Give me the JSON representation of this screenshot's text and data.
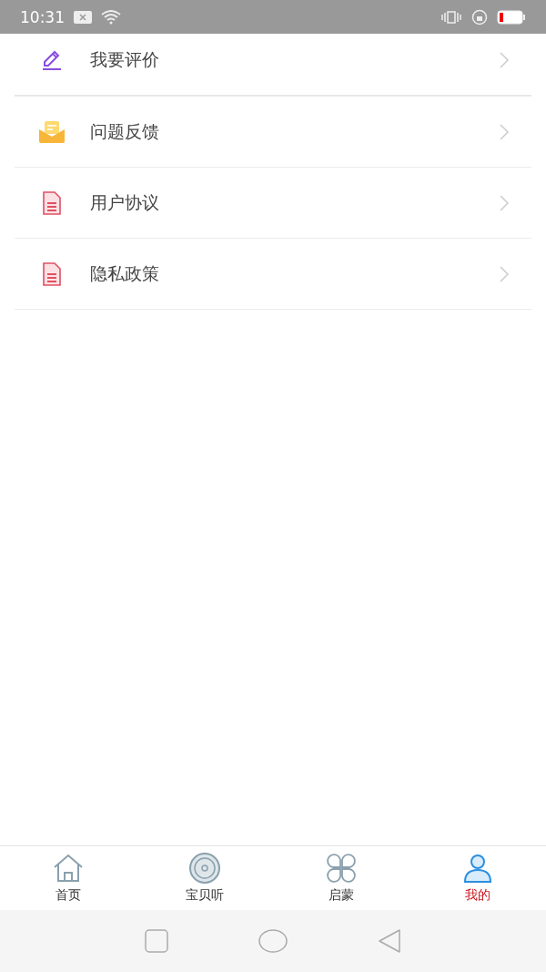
{
  "status_bar": {
    "time": "10:31"
  },
  "menu": [
    {
      "kind": "pencil",
      "label": "我要评价"
    },
    {
      "kind": "mail",
      "label": "问题反馈"
    },
    {
      "kind": "document",
      "label": "用户协议"
    },
    {
      "kind": "document",
      "label": "隐私政策"
    }
  ],
  "tabs": [
    {
      "kind": "home",
      "label": "首页",
      "selected": false
    },
    {
      "kind": "disc",
      "label": "宝贝听",
      "selected": false
    },
    {
      "kind": "grid",
      "label": "启蒙",
      "selected": false
    },
    {
      "kind": "person",
      "label": "我的",
      "selected": true
    }
  ]
}
